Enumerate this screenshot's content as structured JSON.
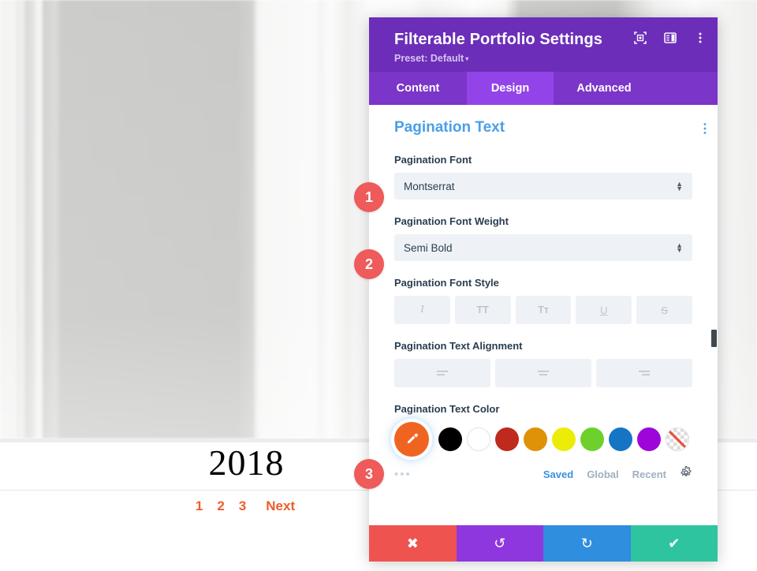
{
  "background": {
    "year_title": "2018",
    "pagination": [
      "1",
      "2",
      "3"
    ],
    "next_label": "Next",
    "accent_color": "#ef5c2b"
  },
  "panel": {
    "title": "Filterable Portfolio Settings",
    "preset_label": "Preset: Default",
    "preset_caret": "▾",
    "header_icons": [
      {
        "name": "focus-target-icon"
      },
      {
        "name": "layout-panel-icon"
      },
      {
        "name": "overflow-menu-icon"
      }
    ],
    "tabs": [
      {
        "label": "Content",
        "active": false
      },
      {
        "label": "Design",
        "active": true
      },
      {
        "label": "Advanced",
        "active": false
      }
    ],
    "header_bg": "#6c2eb9",
    "tab_bg": "#7b35c9",
    "tab_active_bg": "#9344e8"
  },
  "section": {
    "title": "Pagination Text",
    "title_color": "#4a9ee8",
    "menu_dots": "⋮",
    "fields": {
      "font": {
        "label": "Pagination Font",
        "value": "Montserrat"
      },
      "font_weight": {
        "label": "Pagination Font Weight",
        "value": "Semi Bold"
      },
      "font_style": {
        "label": "Pagination Font Style",
        "buttons": [
          {
            "name": "italic-icon",
            "glyph": "I"
          },
          {
            "name": "uppercase-icon",
            "glyph": "TT"
          },
          {
            "name": "small-caps-icon",
            "glyph": "Tт"
          },
          {
            "name": "underline-icon",
            "glyph": "U"
          },
          {
            "name": "strikethrough-icon",
            "glyph": "S"
          }
        ]
      },
      "text_alignment": {
        "label": "Pagination Text Alignment",
        "buttons": [
          {
            "name": "align-left-icon"
          },
          {
            "name": "align-center-icon"
          },
          {
            "name": "align-right-icon"
          }
        ]
      },
      "text_color": {
        "label": "Pagination Text Color",
        "selected_swatch": {
          "name": "eyedropper-swatch",
          "color": "#f06422",
          "selected": true
        },
        "swatches": [
          {
            "name": "swatch-black",
            "color": "#000000"
          },
          {
            "name": "swatch-white",
            "color": "#ffffff"
          },
          {
            "name": "swatch-dark-red",
            "color": "#c0291d"
          },
          {
            "name": "swatch-amber",
            "color": "#dd9208"
          },
          {
            "name": "swatch-yellow",
            "color": "#ecec09"
          },
          {
            "name": "swatch-green",
            "color": "#6ed02a"
          },
          {
            "name": "swatch-blue",
            "color": "#1575c4"
          },
          {
            "name": "swatch-purple",
            "color": "#9d06d8"
          },
          {
            "name": "swatch-transparent",
            "color": "transparent"
          }
        ],
        "more_dots": "•••",
        "mini_tabs": [
          {
            "label": "Saved",
            "active": true
          },
          {
            "label": "Global",
            "active": false
          },
          {
            "label": "Recent",
            "active": false
          }
        ],
        "gear_icon": "gear-icon"
      }
    }
  },
  "action_bar": [
    {
      "name": "cancel-button",
      "glyph": "✖",
      "color": "#ef5350"
    },
    {
      "name": "undo-button",
      "glyph": "↺",
      "color": "#8e37df"
    },
    {
      "name": "redo-button",
      "glyph": "↻",
      "color": "#2f8ede"
    },
    {
      "name": "save-button",
      "glyph": "✔",
      "color": "#2fc4a0"
    }
  ],
  "annotations": [
    {
      "number": "1"
    },
    {
      "number": "2"
    },
    {
      "number": "3"
    }
  ]
}
